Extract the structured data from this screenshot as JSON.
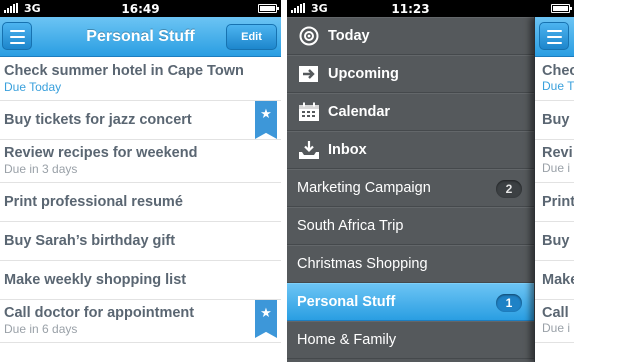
{
  "phone1": {
    "status": {
      "network": "3G",
      "time": "16:49"
    },
    "nav": {
      "title": "Personal Stuff",
      "edit_label": "Edit"
    },
    "tasks": [
      {
        "title": "Check summer hotel in Cape Town",
        "sub": "Due Today"
      },
      {
        "title": "Buy tickets for jazz concert"
      },
      {
        "title": "Review recipes for weekend",
        "sub": "Due in 3 days"
      },
      {
        "title": "Print professional resumé"
      },
      {
        "title": "Buy Sarah’s birthday gift"
      },
      {
        "title": "Make weekly shopping list"
      },
      {
        "title": "Call doctor for appointment",
        "sub": "Due in 6 days"
      }
    ]
  },
  "phone2": {
    "status": {
      "network": "3G",
      "time": "11:23"
    },
    "sidebar": {
      "items": [
        {
          "label": "Today",
          "icon": "today-icon"
        },
        {
          "label": "Upcoming",
          "icon": "upcoming-icon"
        },
        {
          "label": "Calendar",
          "icon": "calendar-icon"
        },
        {
          "label": "Inbox",
          "icon": "inbox-icon"
        },
        {
          "label": "Marketing Campaign",
          "count": "2"
        },
        {
          "label": "South Africa Trip"
        },
        {
          "label": "Christmas Shopping"
        },
        {
          "label": "Personal Stuff",
          "count": "1"
        },
        {
          "label": "Home & Family"
        }
      ]
    },
    "peek_rows": [
      {
        "title": "Chec",
        "sub": "Due T"
      },
      {
        "title": "Buy"
      },
      {
        "title": "Revi",
        "sub": "Due i"
      },
      {
        "title": "Print"
      },
      {
        "title": "Buy"
      },
      {
        "title": "Make"
      },
      {
        "title": "Call",
        "sub": "Due i"
      }
    ]
  },
  "colors": {
    "accent_blue": "#2a9ee2",
    "sidebar_gray": "#55595c",
    "due_today": "#3aa0dc",
    "flag_blue": "#3d97d9"
  }
}
